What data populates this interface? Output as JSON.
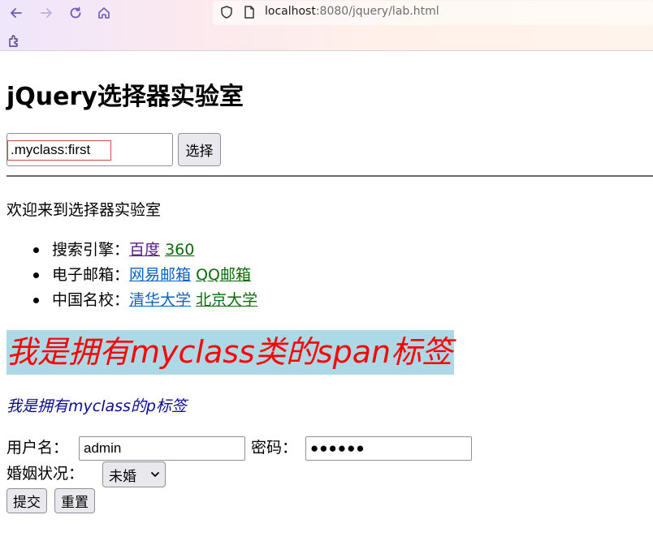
{
  "browser": {
    "url_host": "localhost",
    "url_rest": ":8080/jquery/lab.html"
  },
  "page": {
    "title": "jQuery选择器实验室",
    "selector_input_value": ".myclass:first",
    "select_button_label": "选择",
    "welcome_text": "欢迎来到选择器实验室",
    "list": [
      {
        "label": "搜索引擎：",
        "links": [
          {
            "text": "百度",
            "style": "visited"
          },
          {
            "text": "360",
            "style": "green"
          }
        ]
      },
      {
        "label": "电子邮箱：",
        "links": [
          {
            "text": "网易邮箱",
            "style": "blue"
          },
          {
            "text": "QQ邮箱",
            "style": "green"
          }
        ]
      },
      {
        "label": "中国名校：",
        "links": [
          {
            "text": "清华大学",
            "style": "blue"
          },
          {
            "text": "北京大学",
            "style": "green"
          }
        ]
      }
    ],
    "span_text": "我是拥有myclass类的span标签",
    "p_text": "我是拥有myclass的p标签",
    "form": {
      "username_label": "用户名：",
      "username_value": "admin",
      "password_label": "密码：",
      "password_value": "●●●●●●",
      "marital_label": "婚姻状况：",
      "marital_selected": "未婚",
      "submit_label": "提交",
      "reset_label": "重置"
    }
  },
  "colors": {
    "span_background": "#add8e6",
    "span_text": "#ff0000",
    "p_text": "#0b0b8c",
    "link_visited": "#551a8b",
    "link_blue": "#0a63c4",
    "link_green": "#0b6b0b",
    "selector_highlight_border": "#d24b4b"
  },
  "icons": {
    "back": "arrow-left-icon",
    "forward": "arrow-right-icon",
    "reload": "reload-icon",
    "home": "home-icon",
    "shield": "shield-icon",
    "page": "page-icon",
    "extension": "extension-icon"
  }
}
